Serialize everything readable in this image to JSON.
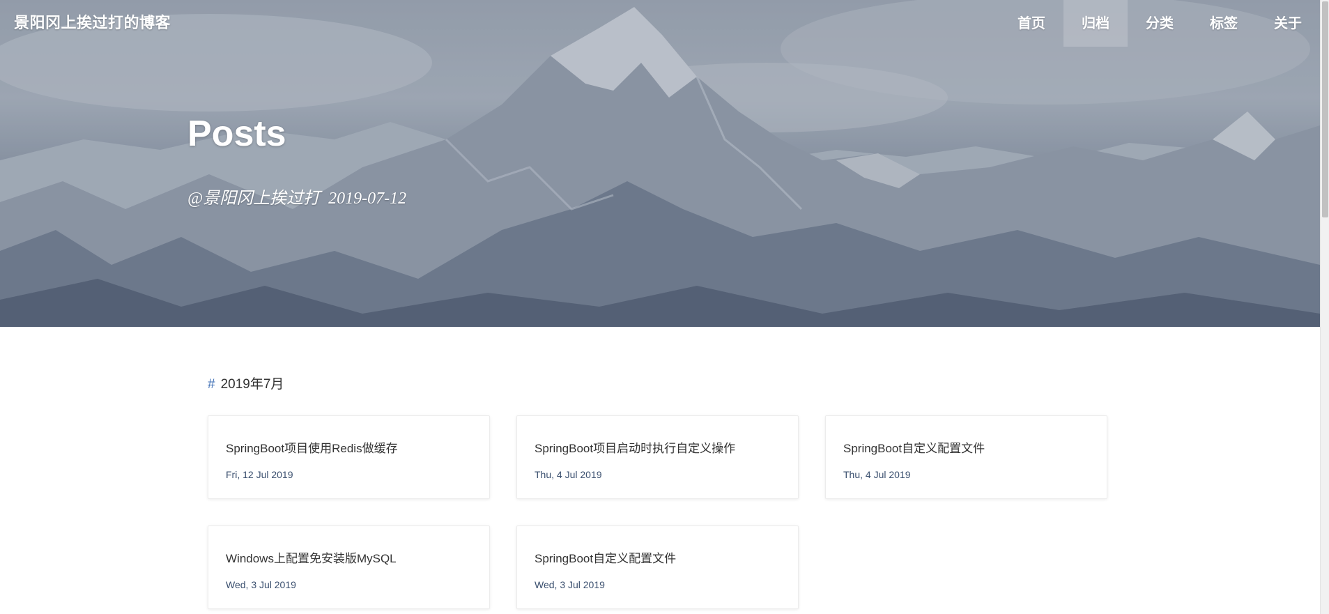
{
  "site": {
    "title": "景阳冈上挨过打的博客"
  },
  "nav": {
    "items": [
      {
        "label": "首页",
        "active": false
      },
      {
        "label": "归档",
        "active": true
      },
      {
        "label": "分类",
        "active": false
      },
      {
        "label": "标签",
        "active": false
      },
      {
        "label": "关于",
        "active": false
      }
    ]
  },
  "hero": {
    "heading": "Posts",
    "author": "@景阳冈上挨过打",
    "date": "2019-07-12"
  },
  "archive": {
    "month": {
      "hash": "#",
      "label": "2019年7月"
    },
    "posts": [
      {
        "title": "SpringBoot项目使用Redis做缓存",
        "date": "Fri, 12 Jul 2019"
      },
      {
        "title": "SpringBoot项目启动时执行自定义操作",
        "date": "Thu, 4 Jul 2019"
      },
      {
        "title": "SpringBoot自定义配置文件",
        "date": "Thu, 4 Jul 2019"
      },
      {
        "title": "Windows上配置免安装版MySQL",
        "date": "Wed, 3 Jul 2019"
      },
      {
        "title": "SpringBoot自定义配置文件",
        "date": "Wed, 3 Jul 2019"
      }
    ]
  },
  "colors": {
    "accent": "#3f6fb5",
    "date_text": "#3a4f6e",
    "title_text": "#333333"
  }
}
